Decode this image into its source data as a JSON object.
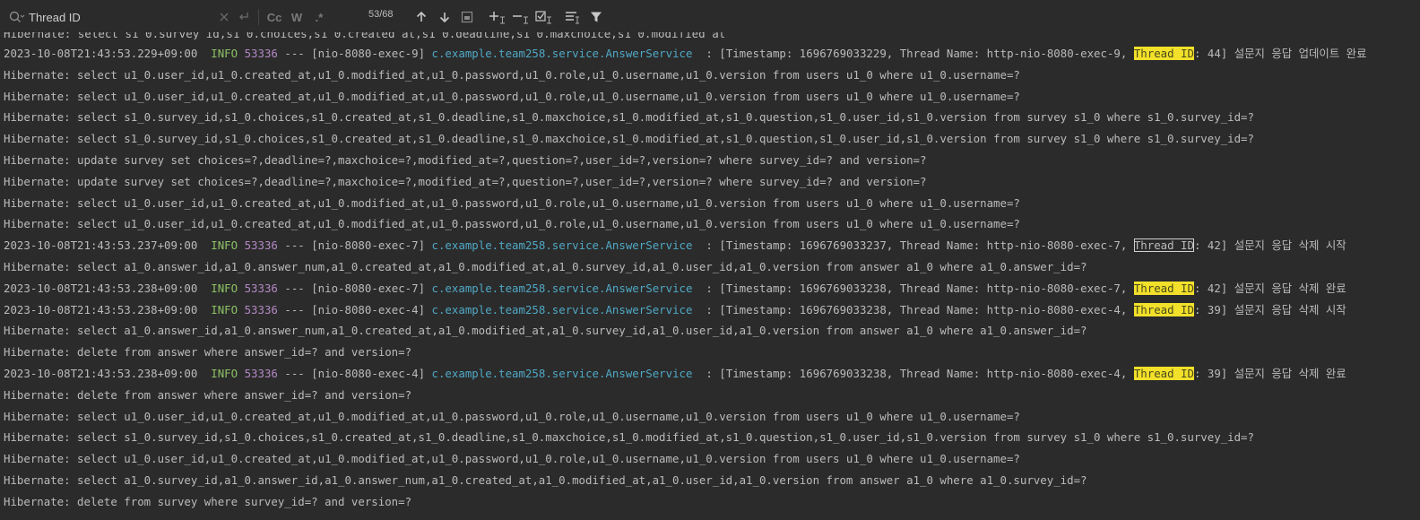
{
  "search": {
    "query": "Thread ID",
    "match_count": "53/68",
    "toggle_case": "Cc",
    "toggle_words": "W",
    "toggle_regex": ".*"
  },
  "icons": {
    "search": "search-icon",
    "clear": "close-icon",
    "replace": "replace-icon",
    "prev": "arrow-up-icon",
    "next": "arrow-down-icon",
    "select_all": "select-all-icon",
    "add_occurrence": "add-selection-icon",
    "remove_occurrence": "remove-selection-icon",
    "select_all_occurrences": "select-all-occurrences-icon",
    "filter_search": "filter-search-icon",
    "filter": "filter-icon"
  },
  "colors": {
    "background": "#2b2b2b",
    "text": "#bbbbbb",
    "info": "#8cc265",
    "pid": "#b389c4",
    "class": "#4fa8c5",
    "highlight": "#f2e02a"
  },
  "log": {
    "partial_line": "Hibernate: select s1_0.survey_id,s1_0.choices,s1_0.created_at,s1_0.deadline,s1_0.maxchoice,s1_0.modified_at",
    "lines": [
      {
        "type": "app",
        "ts": "2023-10-08T21:43:53.229+09:00",
        "level": "INFO",
        "pid": "53336",
        "sep": "---",
        "thread": "[nio-8080-exec-9]",
        "cls": "c.example.team258.service.AnswerService",
        "msg_pre": ": [Timestamp: 1696769033229, Thread Name: http-nio-8080-exec-9, ",
        "match": "Thread ID",
        "msg_post": ": 44] 설문지 응답 업데이트 완료",
        "current": false
      },
      {
        "type": "plain",
        "text": "Hibernate: select u1_0.user_id,u1_0.created_at,u1_0.modified_at,u1_0.password,u1_0.role,u1_0.username,u1_0.version from users u1_0 where u1_0.username=?"
      },
      {
        "type": "plain",
        "text": "Hibernate: select u1_0.user_id,u1_0.created_at,u1_0.modified_at,u1_0.password,u1_0.role,u1_0.username,u1_0.version from users u1_0 where u1_0.username=?"
      },
      {
        "type": "plain",
        "text": "Hibernate: select s1_0.survey_id,s1_0.choices,s1_0.created_at,s1_0.deadline,s1_0.maxchoice,s1_0.modified_at,s1_0.question,s1_0.user_id,s1_0.version from survey s1_0 where s1_0.survey_id=?"
      },
      {
        "type": "plain",
        "text": "Hibernate: select s1_0.survey_id,s1_0.choices,s1_0.created_at,s1_0.deadline,s1_0.maxchoice,s1_0.modified_at,s1_0.question,s1_0.user_id,s1_0.version from survey s1_0 where s1_0.survey_id=?"
      },
      {
        "type": "plain",
        "text": "Hibernate: update survey set choices=?,deadline=?,maxchoice=?,modified_at=?,question=?,user_id=?,version=? where survey_id=? and version=?"
      },
      {
        "type": "plain",
        "text": "Hibernate: update survey set choices=?,deadline=?,maxchoice=?,modified_at=?,question=?,user_id=?,version=? where survey_id=? and version=?"
      },
      {
        "type": "plain",
        "text": "Hibernate: select u1_0.user_id,u1_0.created_at,u1_0.modified_at,u1_0.password,u1_0.role,u1_0.username,u1_0.version from users u1_0 where u1_0.username=?"
      },
      {
        "type": "plain",
        "text": "Hibernate: select u1_0.user_id,u1_0.created_at,u1_0.modified_at,u1_0.password,u1_0.role,u1_0.username,u1_0.version from users u1_0 where u1_0.username=?"
      },
      {
        "type": "app",
        "ts": "2023-10-08T21:43:53.237+09:00",
        "level": "INFO",
        "pid": "53336",
        "sep": "---",
        "thread": "[nio-8080-exec-7]",
        "cls": "c.example.team258.service.AnswerService",
        "msg_pre": ": [Timestamp: 1696769033237, Thread Name: http-nio-8080-exec-7, ",
        "match": "Thread ID",
        "msg_post": ": 42] 설문지 응답 삭제 시작",
        "current": true
      },
      {
        "type": "plain",
        "text": "Hibernate: select a1_0.answer_id,a1_0.answer_num,a1_0.created_at,a1_0.modified_at,a1_0.survey_id,a1_0.user_id,a1_0.version from answer a1_0 where a1_0.answer_id=?"
      },
      {
        "type": "app",
        "ts": "2023-10-08T21:43:53.238+09:00",
        "level": "INFO",
        "pid": "53336",
        "sep": "---",
        "thread": "[nio-8080-exec-7]",
        "cls": "c.example.team258.service.AnswerService",
        "msg_pre": ": [Timestamp: 1696769033238, Thread Name: http-nio-8080-exec-7, ",
        "match": "Thread ID",
        "msg_post": ": 42] 설문지 응답 삭제 완료",
        "current": false
      },
      {
        "type": "app",
        "ts": "2023-10-08T21:43:53.238+09:00",
        "level": "INFO",
        "pid": "53336",
        "sep": "---",
        "thread": "[nio-8080-exec-4]",
        "cls": "c.example.team258.service.AnswerService",
        "msg_pre": ": [Timestamp: 1696769033238, Thread Name: http-nio-8080-exec-4, ",
        "match": "Thread ID",
        "msg_post": ": 39] 설문지 응답 삭제 시작",
        "current": false
      },
      {
        "type": "plain",
        "text": "Hibernate: select a1_0.answer_id,a1_0.answer_num,a1_0.created_at,a1_0.modified_at,a1_0.survey_id,a1_0.user_id,a1_0.version from answer a1_0 where a1_0.answer_id=?"
      },
      {
        "type": "plain",
        "text": "Hibernate: delete from answer where answer_id=? and version=?"
      },
      {
        "type": "app",
        "ts": "2023-10-08T21:43:53.238+09:00",
        "level": "INFO",
        "pid": "53336",
        "sep": "---",
        "thread": "[nio-8080-exec-4]",
        "cls": "c.example.team258.service.AnswerService",
        "msg_pre": ": [Timestamp: 1696769033238, Thread Name: http-nio-8080-exec-4, ",
        "match": "Thread ID",
        "msg_post": ": 39] 설문지 응답 삭제 완료",
        "current": false
      },
      {
        "type": "plain",
        "text": "Hibernate: delete from answer where answer_id=? and version=?"
      },
      {
        "type": "plain",
        "text": "Hibernate: select u1_0.user_id,u1_0.created_at,u1_0.modified_at,u1_0.password,u1_0.role,u1_0.username,u1_0.version from users u1_0 where u1_0.username=?"
      },
      {
        "type": "plain",
        "text": "Hibernate: select s1_0.survey_id,s1_0.choices,s1_0.created_at,s1_0.deadline,s1_0.maxchoice,s1_0.modified_at,s1_0.question,s1_0.user_id,s1_0.version from survey s1_0 where s1_0.survey_id=?"
      },
      {
        "type": "plain",
        "text": "Hibernate: select u1_0.user_id,u1_0.created_at,u1_0.modified_at,u1_0.password,u1_0.role,u1_0.username,u1_0.version from users u1_0 where u1_0.username=?"
      },
      {
        "type": "plain",
        "text": "Hibernate: select a1_0.survey_id,a1_0.answer_id,a1_0.answer_num,a1_0.created_at,a1_0.modified_at,a1_0.user_id,a1_0.version from answer a1_0 where a1_0.survey_id=?"
      },
      {
        "type": "plain",
        "text": "Hibernate: delete from survey where survey_id=? and version=?"
      }
    ]
  }
}
